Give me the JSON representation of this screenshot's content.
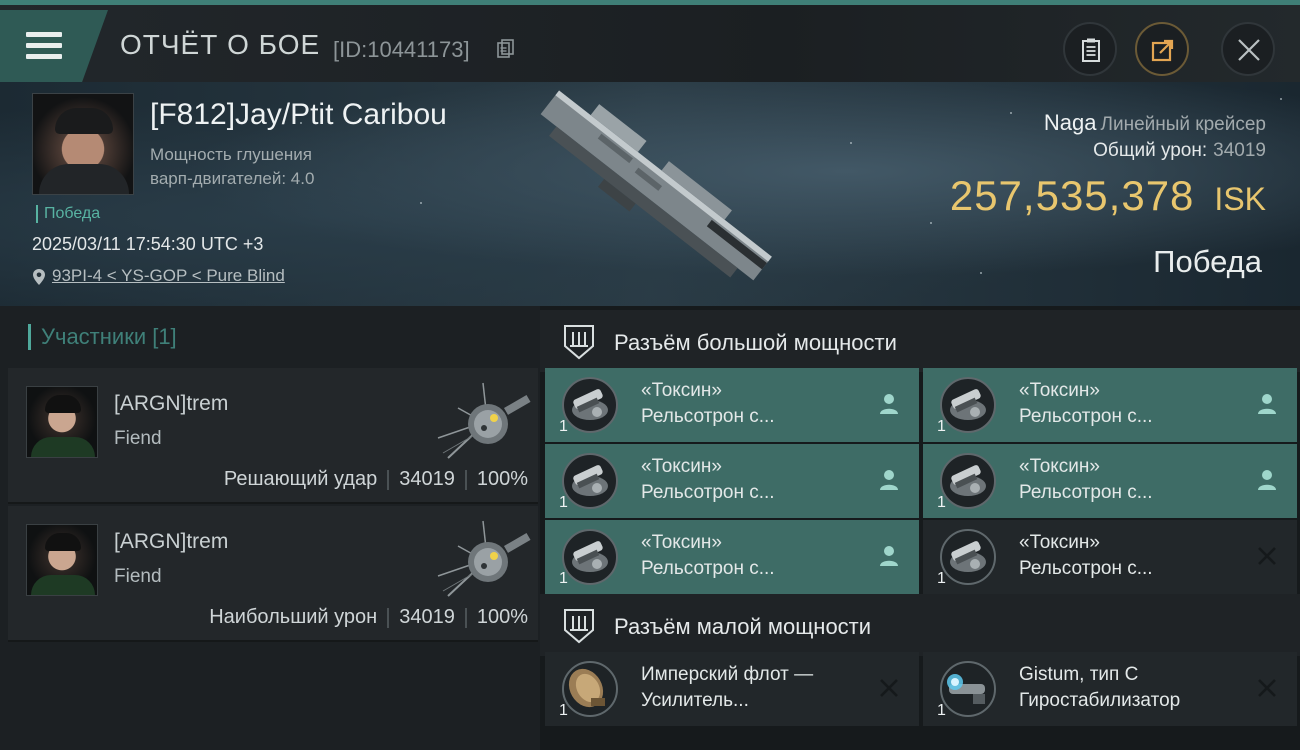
{
  "header": {
    "title": "ОТЧЁТ О БОЕ",
    "report_id": "[ID:10441173]"
  },
  "victim": {
    "name": "[F812]Jay/Ptit Caribou",
    "attribute_line1": "Мощность глушения",
    "attribute_line2": "варп-двигателей: 4.0",
    "result_tag": "Победа",
    "datetime": "2025/03/11 17:54:30 UTC +3",
    "location": "93PI-4 < YS-GOP < Pure Blind",
    "ship_name": "Naga",
    "ship_class": "Линейный крейсер",
    "total_damage_label": "Общий урон:",
    "total_damage": "34019",
    "isk_value": "257,535,378",
    "isk_unit": "ISK",
    "result": "Победа"
  },
  "participants": {
    "title": "Участники [1]",
    "cards": [
      {
        "name": "[ARGN]trem",
        "ship": "Fiend",
        "role": "Решающий удар",
        "damage": "34019",
        "percent": "100%"
      },
      {
        "name": "[ARGN]trem",
        "ship": "Fiend",
        "role": "Наибольший урон",
        "damage": "34019",
        "percent": "100%"
      }
    ]
  },
  "fittings": {
    "high_slot_title": "Разъём большой мощности",
    "low_slot_title": "Разъём малой мощности",
    "high": [
      {
        "line1": "«Токсин»",
        "line2": "Рельсотрон с...",
        "qty": "1",
        "state": "fitted"
      },
      {
        "line1": "«Токсин»",
        "line2": "Рельсотрон с...",
        "qty": "1",
        "state": "fitted"
      },
      {
        "line1": "«Токсин»",
        "line2": "Рельсотрон с...",
        "qty": "1",
        "state": "fitted"
      },
      {
        "line1": "«Токсин»",
        "line2": "Рельсотрон с...",
        "qty": "1",
        "state": "fitted"
      },
      {
        "line1": "«Токсин»",
        "line2": "Рельсотрон с...",
        "qty": "1",
        "state": "fitted"
      },
      {
        "line1": "«Токсин»",
        "line2": "Рельсотрон с...",
        "qty": "1",
        "state": "destroyed"
      }
    ],
    "low": [
      {
        "line1": "Имперский флот —",
        "line2": "Усилитель...",
        "qty": "1",
        "state": "destroyed"
      },
      {
        "line1": "Gistum, тип C",
        "line2": "Гиростабилизатор",
        "qty": "1",
        "state": "destroyed"
      }
    ]
  },
  "colors": {
    "accent_teal": "#3e6c66",
    "isk_gold": "#e8c66e",
    "victory_green": "#58b3a2"
  }
}
